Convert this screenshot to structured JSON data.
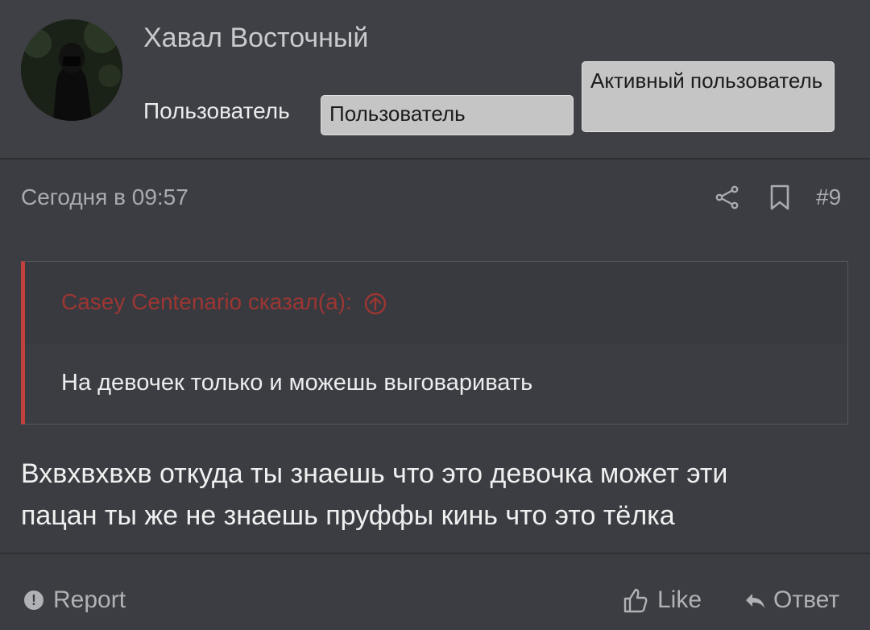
{
  "author": {
    "name": "Хавал Восточный",
    "role": "Пользователь",
    "banners": [
      "Пользователь",
      "Активный пользователь"
    ]
  },
  "post": {
    "date": "Сегодня в 09:57",
    "number": "#9",
    "quote": {
      "author_line": "Casey Centenario сказал(а):",
      "text": "На девочек только и можешь выговаривать"
    },
    "message_lines": [
      "Вхвхвхвхв откуда ты знаешь что это девочка может эти",
      "пацан ты же не знаешь пруффы кинь что это тёлка"
    ]
  },
  "actions": {
    "report": "Report",
    "like": "Like",
    "reply": "Ответ"
  },
  "colors": {
    "background": "#3b3d42",
    "quote_accent": "#c2403e",
    "quote_author": "#9c3633",
    "banner": "#c5c5c5"
  }
}
